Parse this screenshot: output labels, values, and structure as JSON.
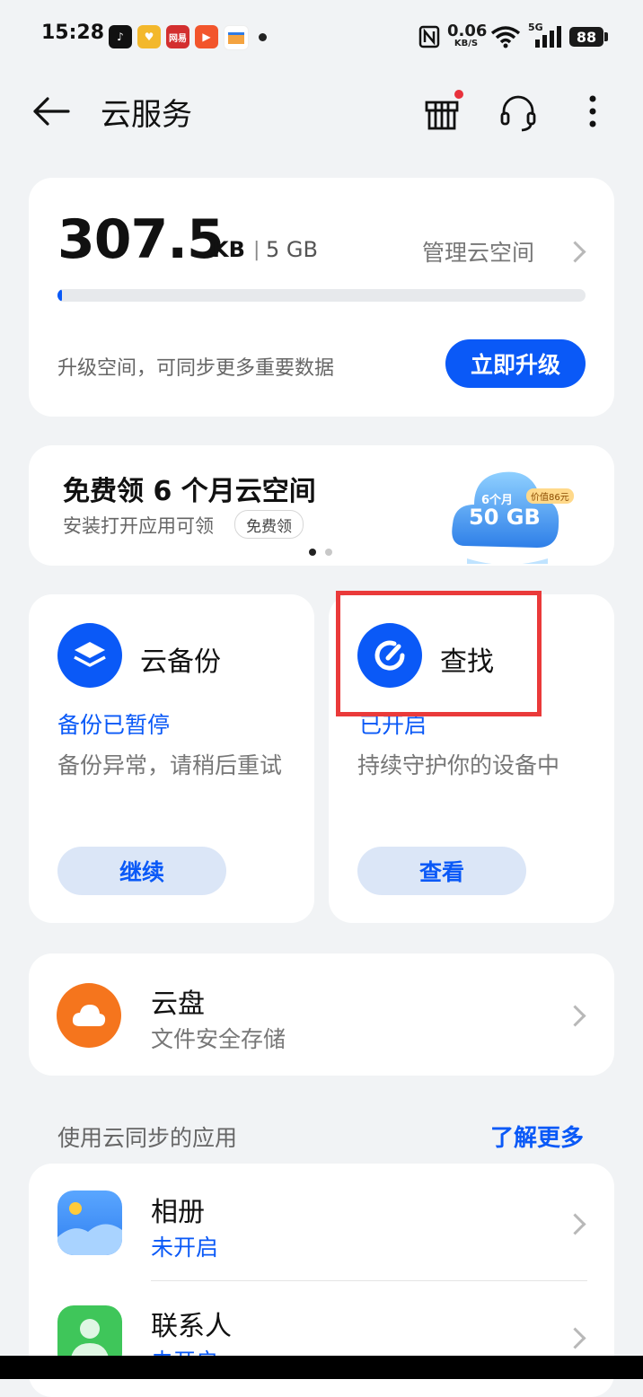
{
  "status_bar": {
    "time": "15:28",
    "apps": [
      {
        "icon": "tiktok-icon",
        "color": "#111111"
      },
      {
        "icon": "heart-app-icon",
        "color": "#f3b82c"
      },
      {
        "icon": "netease-icon",
        "color": "#d32f2f",
        "text": "网易"
      },
      {
        "icon": "video-app-icon",
        "color": "#f2552c"
      },
      {
        "icon": "card-app-icon",
        "color": "#f4a340"
      }
    ],
    "speed_value": "0.06",
    "speed_unit": "KB/S",
    "network": "5G",
    "battery": "88"
  },
  "header": {
    "title": "云服务"
  },
  "storage": {
    "used_value": "307.5",
    "used_unit": "KB",
    "separator": "|",
    "total": "5 GB",
    "manage_label": "管理云空间",
    "progress_fraction": 0.008,
    "upgrade_hint": "升级空间，可同步更多重要数据",
    "upgrade_button": "立即升级"
  },
  "promo": {
    "title": "免费领 6 个月云空间",
    "subtitle": "安装打开应用可领",
    "tag": "免费领",
    "badge_months": "6个月",
    "badge_price": "价值86元",
    "badge_size": "50 GB"
  },
  "backup": {
    "title": "云备份",
    "status": "备份已暂停",
    "description": "备份异常，请稍后重试",
    "button": "继续"
  },
  "find": {
    "title": "查找",
    "status": "已开启",
    "description": "持续守护你的设备中",
    "button": "查看"
  },
  "drive": {
    "title": "云盘",
    "subtitle": "文件安全存储"
  },
  "apps_section": {
    "label": "使用云同步的应用",
    "link": "了解更多",
    "items": [
      {
        "title": "相册",
        "status": "未开启"
      },
      {
        "title": "联系人",
        "status": "未开启"
      }
    ]
  },
  "colors": {
    "accent": "#0a59f7",
    "highlight": "#ea3a3a",
    "drive_icon": "#f5751d",
    "contacts_icon": "#3fc65a"
  }
}
